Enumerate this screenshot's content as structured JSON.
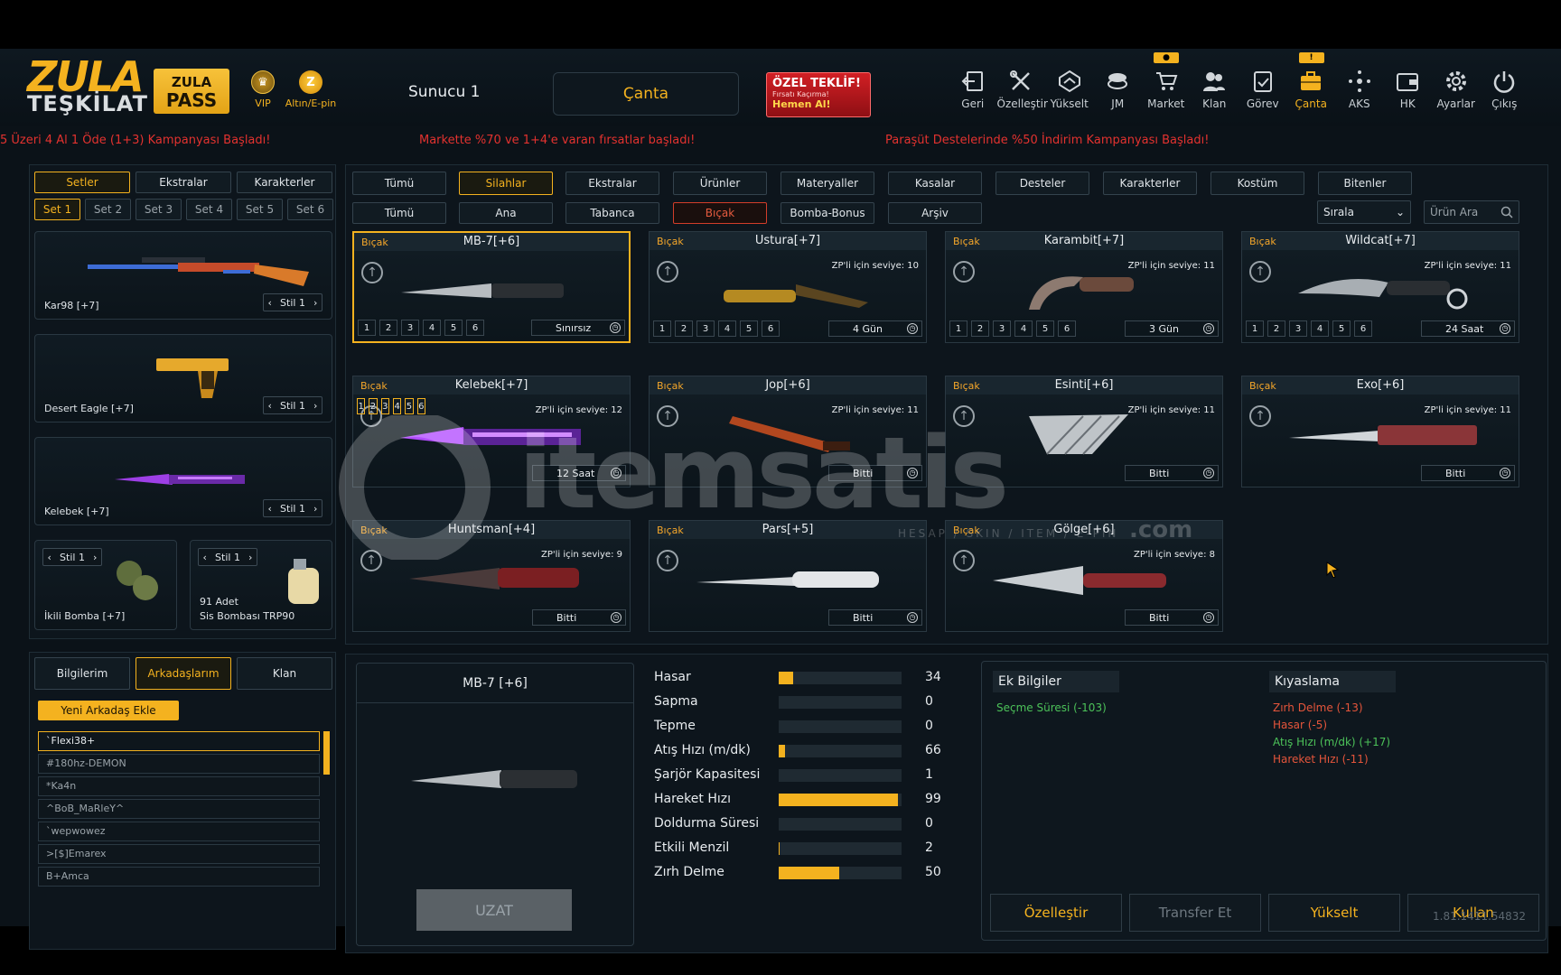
{
  "logo": {
    "line1": "ZULA",
    "line2": "TEŞKİLAT"
  },
  "pass": {
    "line1": "ZULA",
    "line2": "PASS"
  },
  "vip": {
    "label": "VIP"
  },
  "gold": {
    "label": "Altın/E-pin",
    "symbol": "Z"
  },
  "server": "Sunucu 1",
  "bag_title": "Çanta",
  "offer": {
    "title": "ÖZEL TEKLİF!",
    "subtitle": "Fırsatı Kaçırma!",
    "cta": "Hemen Al!"
  },
  "nav": [
    {
      "label": "Geri",
      "icon": "back-icon"
    },
    {
      "label": "Özelleştir",
      "icon": "tools-icon"
    },
    {
      "label": "Yükselt",
      "icon": "upgrade-icon"
    },
    {
      "label": "JM",
      "icon": "coins-icon"
    },
    {
      "label": "Market",
      "icon": "cart-icon"
    },
    {
      "label": "Klan",
      "icon": "users-icon"
    },
    {
      "label": "Görev",
      "icon": "clipboard-icon"
    },
    {
      "label": "Çanta",
      "icon": "bag-icon"
    },
    {
      "label": "AKS",
      "icon": "network-icon"
    },
    {
      "label": "HK",
      "icon": "wallet-icon"
    },
    {
      "label": "Ayarlar",
      "icon": "gear-icon"
    },
    {
      "label": "Çıkış",
      "icon": "power-icon"
    }
  ],
  "badges": {
    "market": "●",
    "bag": "!"
  },
  "tickers": [
    "5 Üzeri 4 Al 1 Öde (1+3) Kampanyası Başladı!",
    "Markette %70 ve 1+4'e varan fırsatlar başladı!",
    "Paraşüt Destelerinde %50 İndirim Kampanyası Başladı!"
  ],
  "left_tabs": [
    "Setler",
    "Ekstralar",
    "Karakterler"
  ],
  "set_tabs": [
    "Set 1",
    "Set 2",
    "Set 3",
    "Set 4",
    "Set 5",
    "Set 6"
  ],
  "set_items": [
    {
      "name": "Kar98 [+7]",
      "style": "Stil 1"
    },
    {
      "name": "Desert Eagle [+7]",
      "style": "Stil 1"
    },
    {
      "name": "Kelebek [+7]",
      "style": "Stil 1"
    }
  ],
  "grenades": [
    {
      "name": "İkili Bomba [+7]",
      "style": "Stil 1"
    },
    {
      "count": "91 Adet",
      "name": "Sis Bombası TRP90",
      "style": "Stil 1"
    }
  ],
  "social_tabs": [
    "Bilgilerim",
    "Arkadaşlarım",
    "Klan"
  ],
  "add_friend": "Yeni Arkadaş Ekle",
  "friends": [
    "`Flexi38+",
    "#180hz-DEMON",
    "*Ka4n",
    "^BoB_MaRleY^",
    "`wepwowez",
    ">[$]Emarex",
    "B+Amca"
  ],
  "main_tabs": [
    "Tümü",
    "Silahlar",
    "Ekstralar",
    "Ürünler",
    "Materyaller",
    "Kasalar",
    "Desteler",
    "Karakterler",
    "Kostüm",
    "Bitenler"
  ],
  "sub_tabs": [
    "Tümü",
    "Ana",
    "Tabanca",
    "Bıçak",
    "Bomba-Bonus",
    "Arşiv"
  ],
  "sort_label": "Sırala",
  "search_placeholder": "Ürün Ara",
  "items": [
    {
      "cat": "Bıçak",
      "name": "MB-7[+6]",
      "level": "",
      "time": "Sınırsız",
      "nums": [
        "1",
        "2",
        "3",
        "4",
        "5",
        "6"
      ]
    },
    {
      "cat": "Bıçak",
      "name": "Ustura[+7]",
      "level": "ZP'li için seviye: 10",
      "time": "4 Gün",
      "nums": [
        "1",
        "2",
        "3",
        "4",
        "5",
        "6"
      ]
    },
    {
      "cat": "Bıçak",
      "name": "Karambit[+7]",
      "level": "ZP'li için seviye: 11",
      "time": "3 Gün",
      "nums": [
        "1",
        "2",
        "3",
        "4",
        "5",
        "6"
      ]
    },
    {
      "cat": "Bıçak",
      "name": "Wildcat[+7]",
      "level": "ZP'li için seviye: 11",
      "time": "24 Saat",
      "nums": [
        "1",
        "2",
        "3",
        "4",
        "5",
        "6"
      ]
    },
    {
      "cat": "Bıçak",
      "name": "Kelebek[+7]",
      "level": "ZP'li için seviye: 12",
      "time": "12 Saat",
      "nums": [
        "1",
        "2",
        "3",
        "4",
        "5",
        "6"
      ]
    },
    {
      "cat": "Bıçak",
      "name": "Jop[+6]",
      "level": "ZP'li için seviye: 11",
      "time": "Bitti",
      "nums": []
    },
    {
      "cat": "Bıçak",
      "name": "Esinti[+6]",
      "level": "ZP'li için seviye: 11",
      "time": "Bitti",
      "nums": []
    },
    {
      "cat": "Bıçak",
      "name": "Exo[+6]",
      "level": "ZP'li için seviye: 11",
      "time": "Bitti",
      "nums": []
    },
    {
      "cat": "Bıçak",
      "name": "Huntsman[+4]",
      "level": "ZP'li için seviye: 9",
      "time": "Bitti",
      "nums": []
    },
    {
      "cat": "Bıçak",
      "name": "Pars[+5]",
      "level": "",
      "time": "Bitti",
      "nums": []
    },
    {
      "cat": "Bıçak",
      "name": "Gölge[+6]",
      "level": "ZP'li için seviye: 8",
      "time": "Bitti",
      "nums": []
    }
  ],
  "detail": {
    "title": "MB-7 [+6]",
    "extend": "UZAT"
  },
  "stats": [
    {
      "label": "Hasar",
      "value": "34",
      "fill": 0.12
    },
    {
      "label": "Sapma",
      "value": "0",
      "fill": 0
    },
    {
      "label": "Tepme",
      "value": "0",
      "fill": 0
    },
    {
      "label": "Atış Hızı (m/dk)",
      "value": "66",
      "fill": 0.05
    },
    {
      "label": "Şarjör Kapasitesi",
      "value": "1",
      "fill": 0
    },
    {
      "label": "Hareket Hızı",
      "value": "99",
      "fill": 0.97
    },
    {
      "label": "Doldurma Süresi",
      "value": "0",
      "fill": 0
    },
    {
      "label": "Etkili Menzil",
      "value": "2",
      "fill": 0.01
    },
    {
      "label": "Zırh Delme",
      "value": "50",
      "fill": 0.49
    }
  ],
  "extra_info": {
    "title": "Ek Bilgiler",
    "lines": [
      "Seçme Süresi (-103)"
    ]
  },
  "compare": {
    "title": "Kıyaslama",
    "lines": [
      {
        "text": "Zırh Delme (-13)",
        "tone": "neg"
      },
      {
        "text": "Hasar (-5)",
        "tone": "neg"
      },
      {
        "text": "Atış Hızı (m/dk) (+17)",
        "tone": "pos"
      },
      {
        "text": "Hareket Hızı (-11)",
        "tone": "neg"
      }
    ]
  },
  "actions": [
    "Özelleştir",
    "Transfer Et",
    "Yükselt",
    "Kullan"
  ],
  "version": "1.81.1411.54832",
  "watermark": {
    "brand": "itemsatis",
    "domain": ".com",
    "tagline": "HESAP / SKIN / ITEM / E-PIN"
  },
  "colors": {
    "accent": "#f4b21f",
    "danger": "#e3322f",
    "positive": "#4cc259"
  }
}
